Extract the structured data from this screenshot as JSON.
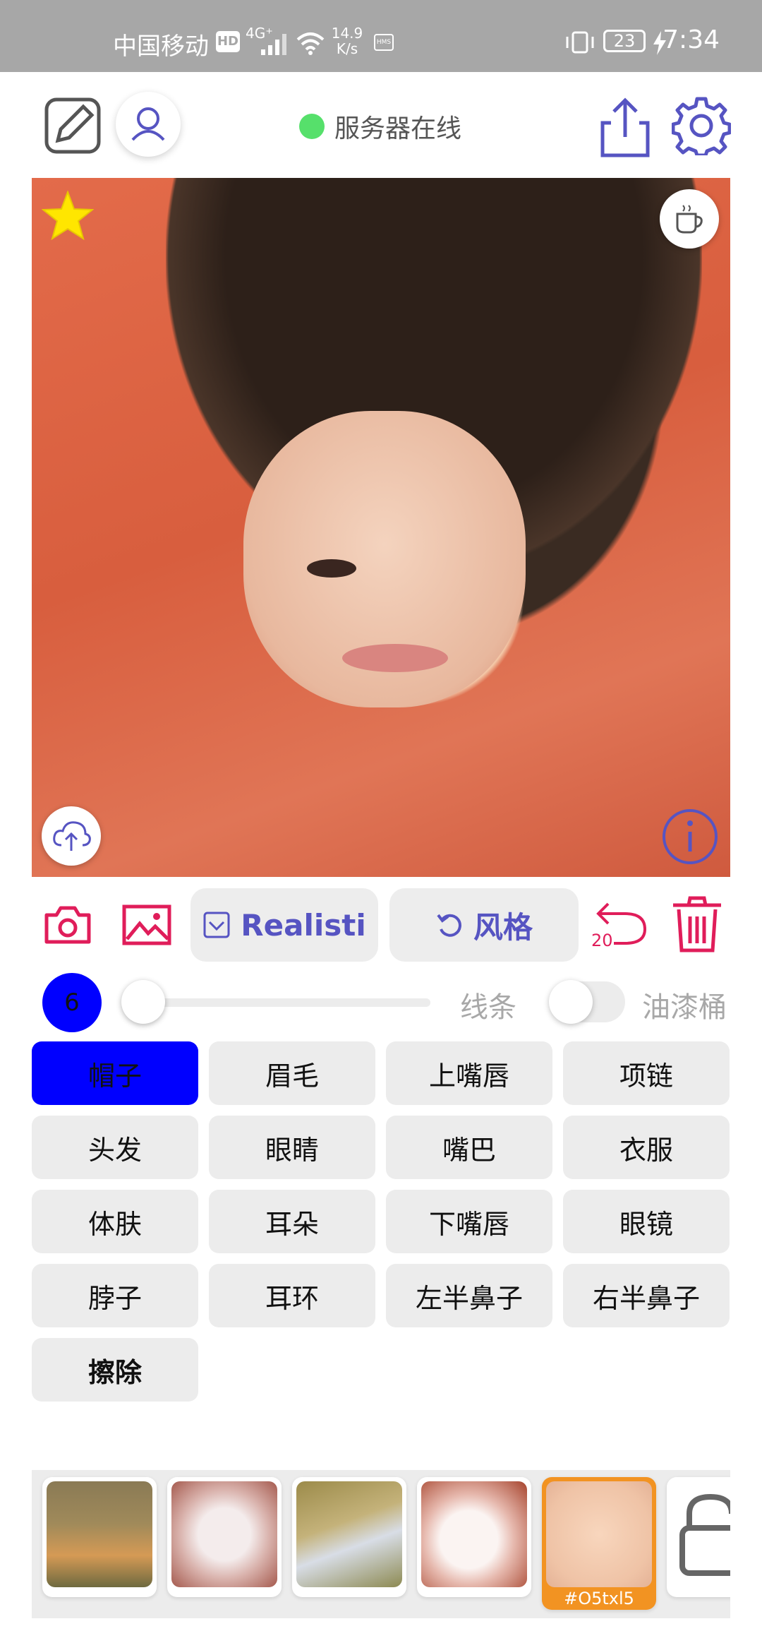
{
  "status_bar": {
    "carrier": "中国移动",
    "hd": "HD",
    "network": "4G⁺",
    "speed_value": "14.9",
    "speed_unit": "K/s",
    "hms": "HMS",
    "battery": "23",
    "time": "7:34"
  },
  "header": {
    "server_status": "服务器在线",
    "server_status_color": "#56e06b"
  },
  "actions": {
    "style_label": "Realisti",
    "restyle_label": "风格",
    "undo_count": "20"
  },
  "brush": {
    "size": "6",
    "line_label": "线条",
    "bucket_label": "油漆桶",
    "line_slider_fraction": 0.0,
    "bucket_toggle_on": false
  },
  "segments": [
    {
      "label": "帽子",
      "active": true
    },
    {
      "label": "眉毛"
    },
    {
      "label": "上嘴唇"
    },
    {
      "label": "项链"
    },
    {
      "label": "头发"
    },
    {
      "label": "眼睛"
    },
    {
      "label": "嘴巴"
    },
    {
      "label": "衣服"
    },
    {
      "label": "体肤"
    },
    {
      "label": "耳朵"
    },
    {
      "label": "下嘴唇"
    },
    {
      "label": "眼镜"
    },
    {
      "label": "脖子"
    },
    {
      "label": "耳环"
    },
    {
      "label": "左半鼻子"
    },
    {
      "label": "右半鼻子"
    },
    {
      "label": "擦除",
      "bold": true
    }
  ],
  "thumbnails": {
    "selected_caption": "#O5txl5"
  },
  "colors": {
    "accent_blue": "#0000ff",
    "icon_purple": "#5654c2",
    "icon_red": "#e01d5a",
    "selected_orange": "#f29322"
  }
}
